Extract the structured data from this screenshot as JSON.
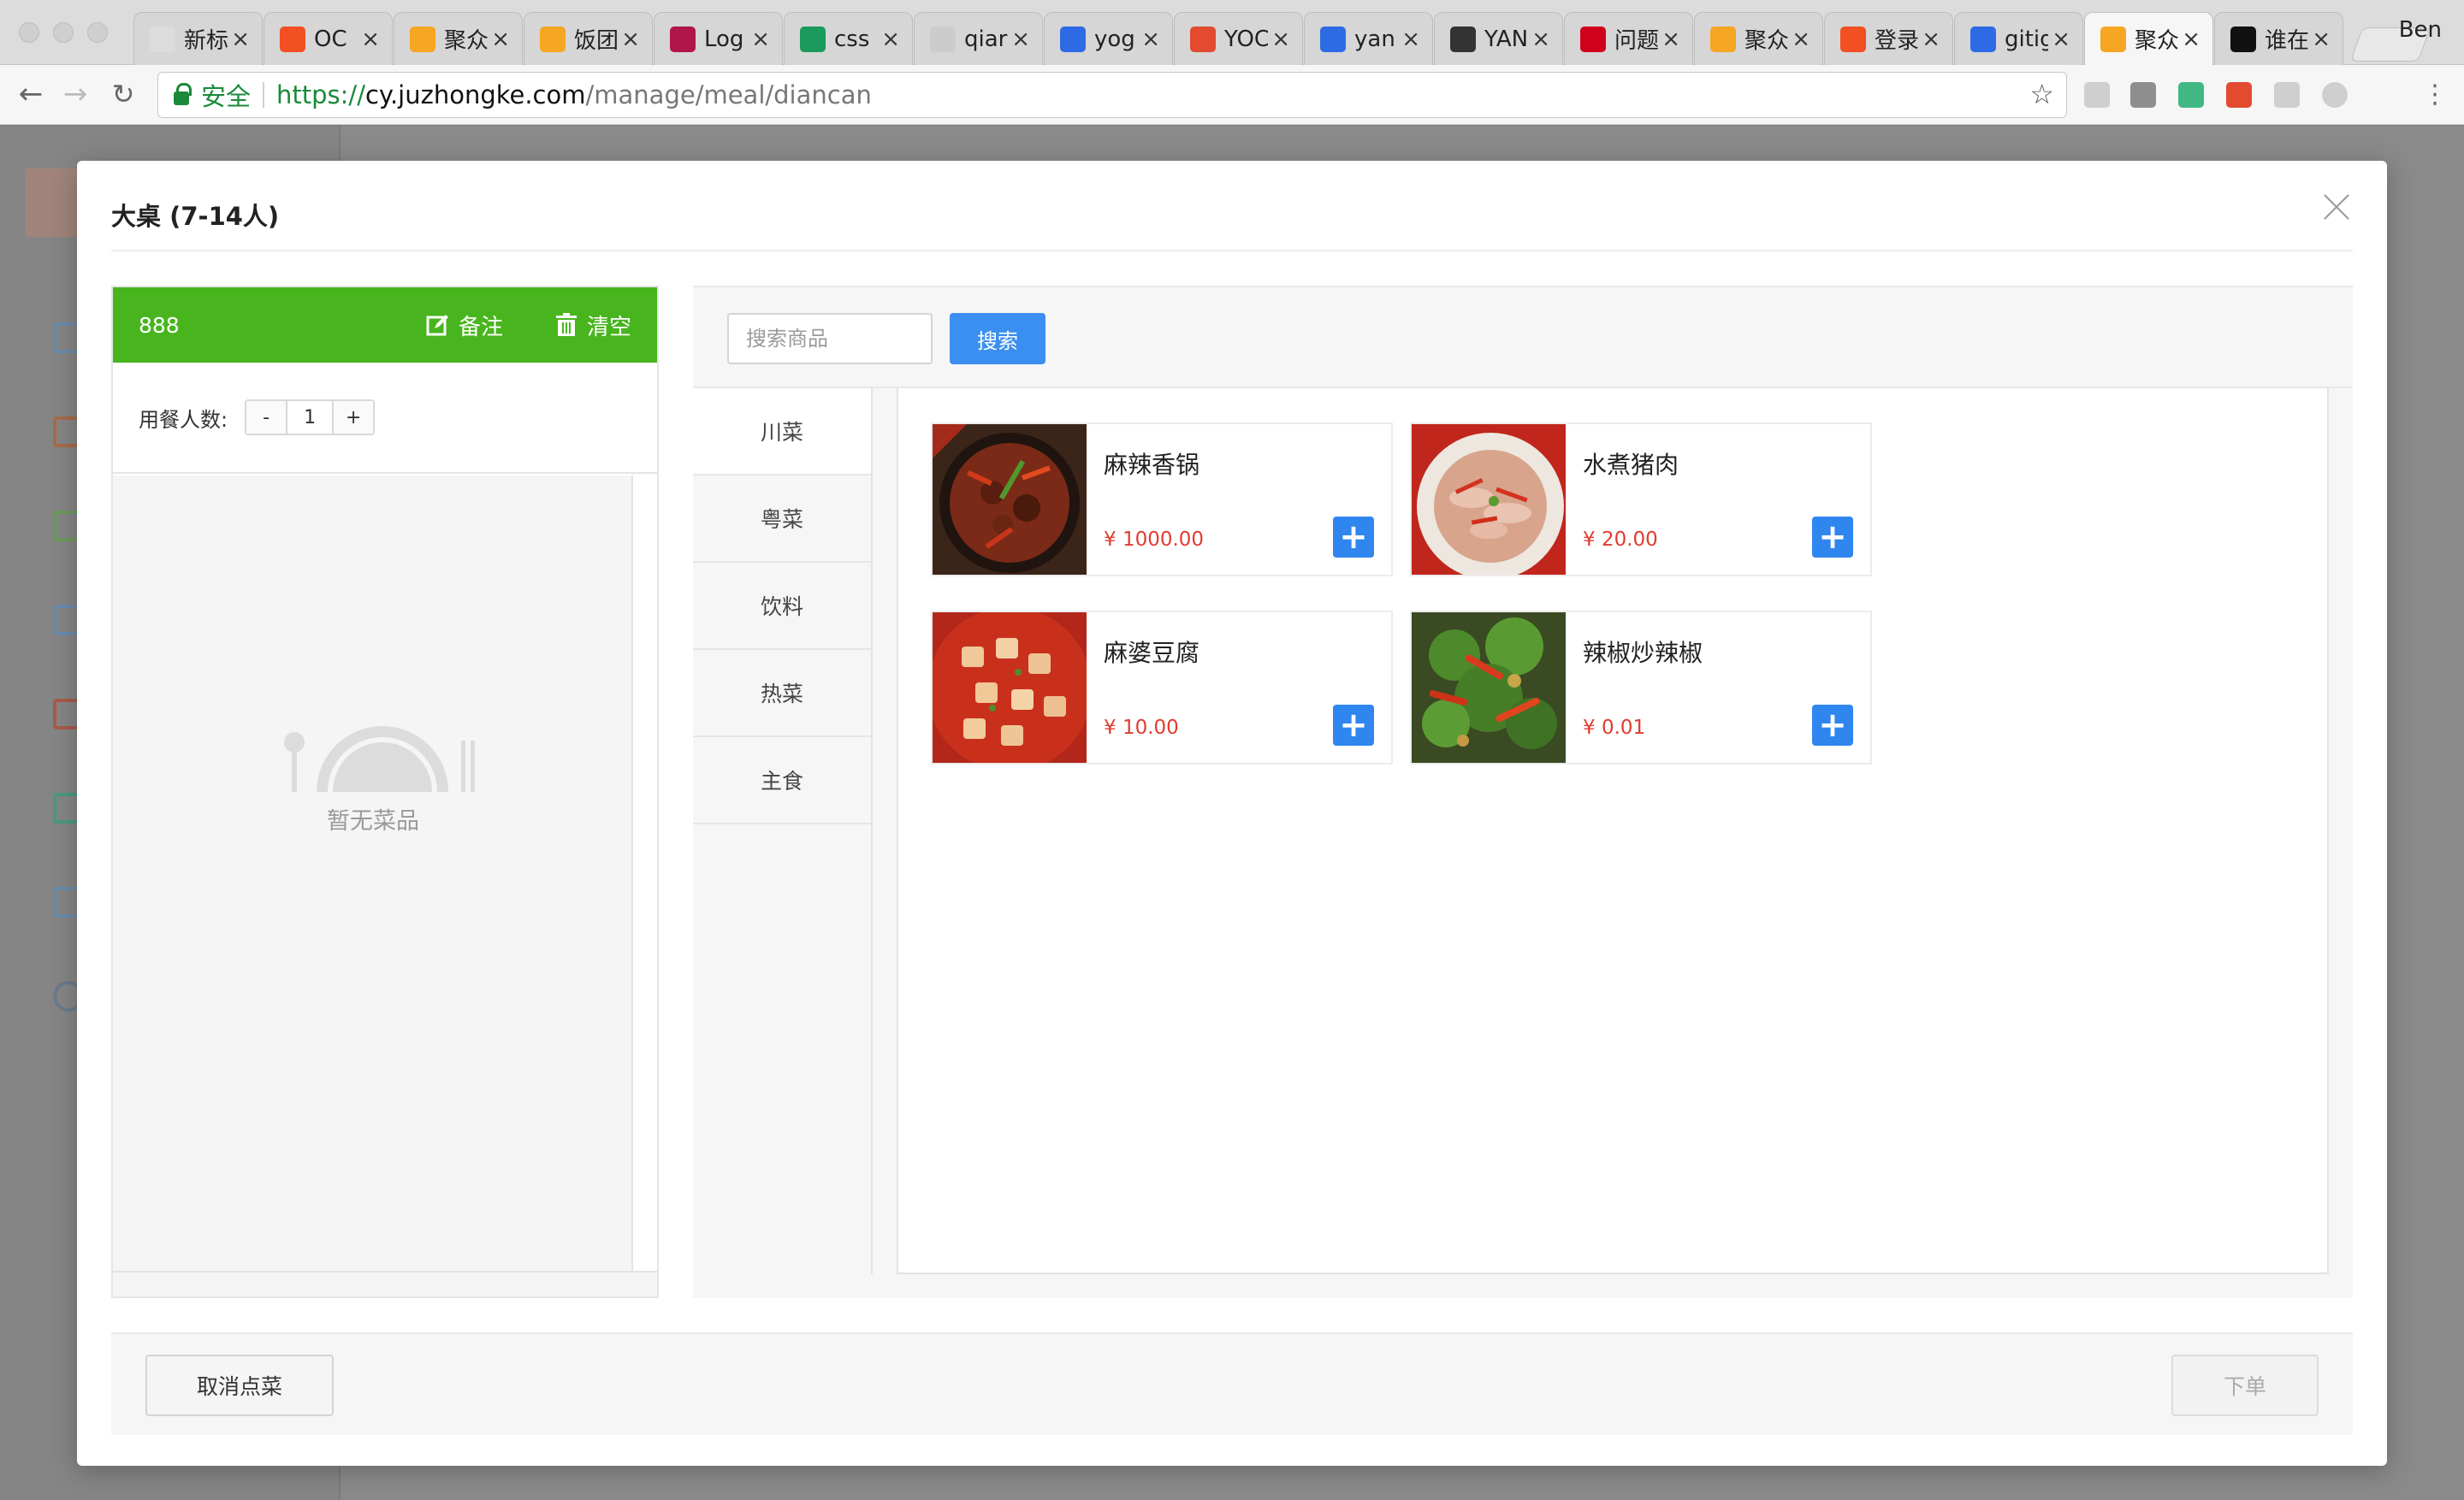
{
  "browser": {
    "tabs": [
      {
        "title": "新标签",
        "favicon": "blank-page-icon",
        "color": "#dcdcdc"
      },
      {
        "title": "OC",
        "favicon": "microsoft-icon",
        "color": "#f25022"
      },
      {
        "title": "聚众",
        "favicon": "jzk-icon",
        "color": "#f5a623"
      },
      {
        "title": "饭团",
        "favicon": "jzk-icon",
        "color": "#f5a623"
      },
      {
        "title": "Log",
        "favicon": "r-logo-icon",
        "color": "#b0164a"
      },
      {
        "title": "css",
        "favicon": "sf-icon",
        "color": "#1a9a5b"
      },
      {
        "title": "qiar",
        "favicon": "document-icon",
        "color": "#cccccc"
      },
      {
        "title": "yog",
        "favicon": "baidu-paw-icon",
        "color": "#2d6be4"
      },
      {
        "title": "YOC",
        "favicon": "fex-icon",
        "color": "#e24b2f"
      },
      {
        "title": "yan",
        "favicon": "baidu-paw-icon",
        "color": "#2d6be4"
      },
      {
        "title": "YAN",
        "favicon": "script-icon",
        "color": "#333333"
      },
      {
        "title": "问题",
        "favicon": "gauge-icon",
        "color": "#d0021b"
      },
      {
        "title": "聚众",
        "favicon": "jzk-icon",
        "color": "#f5a623"
      },
      {
        "title": "登录",
        "favicon": "microsoft-icon",
        "color": "#f25022"
      },
      {
        "title": "gitig",
        "favicon": "baidu-paw-icon",
        "color": "#2d6be4"
      },
      {
        "title": "聚众",
        "favicon": "jzk-icon",
        "color": "#f5a623",
        "active": true
      },
      {
        "title": "谁在",
        "favicon": "github-icon",
        "color": "#111111"
      }
    ],
    "profile_name": "Ben",
    "secure_label": "安全",
    "url_scheme": "https://",
    "url_host": "cy.juzhongke.com",
    "url_path": "/manage/meal/diancan"
  },
  "modal": {
    "title": "大桌 (7-14人)",
    "cart": {
      "table_no": "888",
      "note_label": "备注",
      "clear_label": "清空",
      "people_label": "用餐人数:",
      "people_minus": "-",
      "people_count": "1",
      "people_plus": "+",
      "empty_text": "暂无菜品"
    },
    "search": {
      "placeholder": "搜索商品",
      "button_label": "搜索"
    },
    "categories": [
      "川菜",
      "粤菜",
      "饮料",
      "热菜",
      "主食"
    ],
    "dishes": [
      {
        "name": "麻辣香锅",
        "price": "¥ 1000.00"
      },
      {
        "name": "水煮猪肉",
        "price": "¥ 20.00"
      },
      {
        "name": "麻婆豆腐",
        "price": "¥ 10.00"
      },
      {
        "name": "辣椒炒辣椒",
        "price": "¥ 0.01"
      }
    ],
    "footer": {
      "cancel_label": "取消点菜",
      "order_label": "下单"
    }
  },
  "colors": {
    "cart_header": "#48b51e",
    "primary_button": "#3a8ff0",
    "price": "#e03c31",
    "add_button": "#2f86ef"
  }
}
